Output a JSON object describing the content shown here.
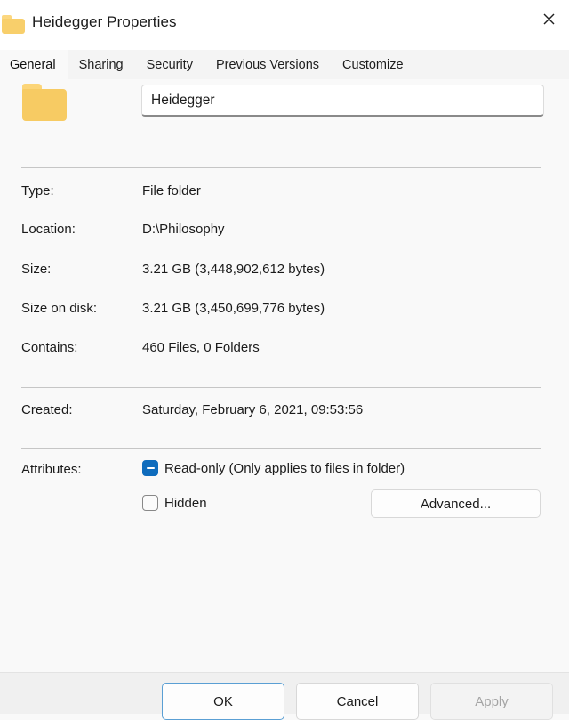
{
  "window": {
    "title": "Heidegger Properties",
    "icon": "folder-icon",
    "close_label": "Close"
  },
  "tabs": [
    {
      "label": "General",
      "active": true
    },
    {
      "label": "Sharing",
      "active": false
    },
    {
      "label": "Security",
      "active": false
    },
    {
      "label": "Previous Versions",
      "active": false
    },
    {
      "label": "Customize",
      "active": false
    }
  ],
  "general": {
    "folder_icon": "folder-icon",
    "name_value": "Heidegger",
    "name_placeholder": "",
    "properties": [
      {
        "label": "Type:",
        "value": "File folder"
      },
      {
        "label": "Location:",
        "value": "D:\\Philosophy"
      },
      {
        "label": "Size:",
        "value": "3.21 GB (3,448,902,612 bytes)"
      },
      {
        "label": "Size on disk:",
        "value": "3.21 GB (3,450,699,776 bytes)"
      },
      {
        "label": "Contains:",
        "value": "460 Files, 0 Folders"
      }
    ],
    "created": {
      "label": "Created:",
      "value": "Saturday, February 6, 2021, 09:53:56"
    },
    "attributes": {
      "label": "Attributes:",
      "readonly": {
        "label": "Read-only (Only applies to files in folder)",
        "state": "indeterminate"
      },
      "hidden": {
        "label": "Hidden",
        "state": "unchecked"
      },
      "advanced_button": "Advanced..."
    }
  },
  "footer": {
    "ok": "OK",
    "cancel": "Cancel",
    "apply": "Apply",
    "apply_disabled": true
  },
  "colors": {
    "accent": "#0f6cbd",
    "focus_border": "#5a9fd4",
    "folder_body": "#f7cb63",
    "folder_tab": "#fcd578",
    "window_bg": "#f9f9f9",
    "tabstrip_bg": "#f4f4f4",
    "footer_bg": "#f0f0f0",
    "separator": "#c6c6c6",
    "text": "#1b1b1b",
    "disabled_text": "#a4a4a4"
  }
}
